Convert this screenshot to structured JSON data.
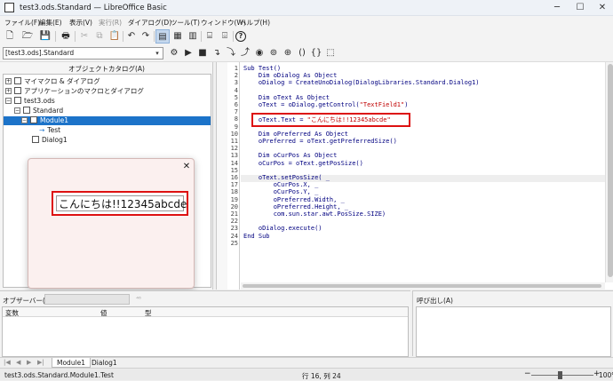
{
  "window": {
    "title": "test3.ods.Standard — LibreOffice Basic",
    "minimize": "─",
    "maximize": "☐",
    "close": "✕"
  },
  "menu": [
    "ファイル(F)",
    "編集(E)",
    "表示(V)",
    "実行(R)",
    "ダイアログ(D)",
    "ツール(T)",
    "ウィンドウ(W)",
    "ヘルプ(H)"
  ],
  "library_combo": {
    "value": "[test3.ods].Standard",
    "arrow": "▾"
  },
  "catalog": {
    "title": "オブジェクトカタログ(A)",
    "items": [
      {
        "label": "マイマクロ & ダイアログ",
        "expander": "+"
      },
      {
        "label": "アプリケーションのマクロとダイアログ",
        "expander": "+"
      },
      {
        "label": "test3.ods",
        "expander": "−"
      },
      {
        "label": "Standard",
        "expander": "−"
      },
      {
        "label": "Module1",
        "expander": "−"
      },
      {
        "label": "Test",
        "bullet": "→"
      },
      {
        "label": "Dialog1"
      }
    ]
  },
  "dialog": {
    "close": "✕",
    "text_field_value": "こんにちは!!12345abcde"
  },
  "editor": {
    "line_numbers": [
      "1",
      "2",
      "3",
      "4",
      "5",
      "6",
      "7",
      "8",
      "9",
      "10",
      "11",
      "12",
      "13",
      "14",
      "15",
      "16",
      "17",
      "18",
      "19",
      "20",
      "21",
      "22",
      "23",
      "24",
      "25"
    ],
    "lines": [
      "Sub Test()",
      "    Dim oDialog As Object",
      "    oDialog = CreateUnoDialog(DialogLibraries.Standard.Dialog1)",
      "",
      "    Dim oText As Object",
      "    oText = oDialog.getControl(\"TextField1\")",
      "",
      "    oText.Text = \"こんにちは!!12345abcde\"",
      "",
      "    Dim oPreferred As Object",
      "    oPreferred = oText.getPreferredSize()",
      "",
      "    Dim oCurPos As Object",
      "    oCurPos = oText.getPosSize()",
      "",
      "    oText.setPosSize( _",
      "        oCurPos.X, _",
      "        oCurPos.Y, _",
      "        oPreferred.Width, _",
      "        oPreferred.Height, _",
      "        com.sun.star.awt.PosSize.SIZE)",
      "",
      "    oDialog.execute()",
      "End Sub",
      ""
    ]
  },
  "watch": {
    "label": "オブザーバー(A):",
    "columns": [
      "変数",
      "値",
      "型"
    ],
    "add_icon": "⁴⁶"
  },
  "callstack": {
    "label": "呼び出し(A)"
  },
  "tabs": {
    "nav": [
      "|◀",
      "◀",
      "▶",
      "▶|"
    ],
    "module1": "Module1",
    "dialog1": "Dialog1"
  },
  "status": {
    "left": "test3.ods.Standard.Module1.Test",
    "position": "行 16, 列 24",
    "zoom": "100%",
    "minus": "−",
    "plus": "+"
  }
}
